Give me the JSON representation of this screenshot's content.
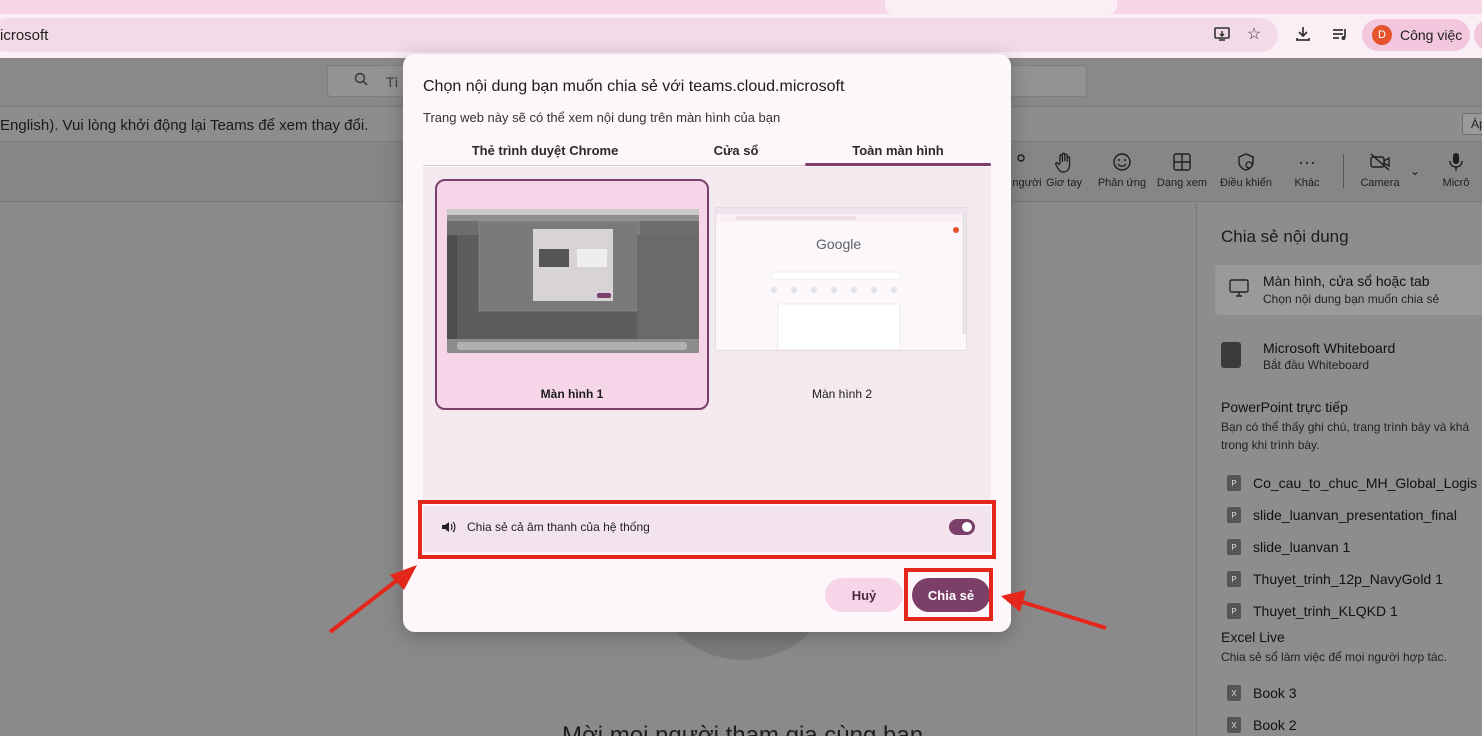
{
  "browser": {
    "url_text": "icrosoft",
    "profile_initial": "D",
    "profile_label": "Công việc",
    "icons": [
      "install-app-icon",
      "bookmark-star-icon",
      "download-icon",
      "reading-list-icon"
    ]
  },
  "teams": {
    "search_placeholder": "Tì",
    "notice_text": "English). Vui lòng khởi động lại Teams để xem thay đổi.",
    "notice_button": "Áp",
    "toolbar": [
      {
        "label": "người",
        "icon": "people-icon"
      },
      {
        "label": "Giơ tay",
        "icon": "raise-hand-icon"
      },
      {
        "label": "Phản ứng",
        "icon": "reaction-icon"
      },
      {
        "label": "Dạng xem",
        "icon": "view-icon"
      },
      {
        "label": "Điều khiển",
        "icon": "controls-icon"
      },
      {
        "label": "Khác",
        "icon": "more-icon"
      },
      {
        "label": "Camera",
        "icon": "camera-off-icon"
      },
      {
        "label": "Micrô",
        "icon": "mic-icon"
      }
    ],
    "stage_text": "Mời mọi người tham gia cùng bạn"
  },
  "share_panel": {
    "title": "Chia sẻ nội dung",
    "screen_option": {
      "title": "Màn hình, cửa sổ hoặc tab",
      "subtitle": "Chọn nội dung bạn muốn chia sẻ"
    },
    "whiteboard": {
      "title": "Microsoft Whiteboard",
      "subtitle": "Bắt đầu Whiteboard"
    },
    "powerpoint": {
      "title": "PowerPoint trực tiếp",
      "desc": "Bạn có thể thấy ghi chú, trang trình bày và khá trong khi trình bày.",
      "files": [
        "Co_cau_to_chuc_MH_Global_Logis",
        "slide_luanvan_presentation_final",
        "slide_luanvan 1",
        "Thuyet_trinh_12p_NavyGold 1",
        "Thuyet_trinh_KLQKD 1"
      ]
    },
    "excel": {
      "title": "Excel Live",
      "desc": "Chia sẻ sổ làm việc để mọi người hợp tác.",
      "files": [
        "Book 3",
        "Book 2"
      ]
    }
  },
  "dialog": {
    "title": "Chọn nội dung bạn muốn chia sẻ với teams.cloud.microsoft",
    "subtitle": "Trang web này sẽ có thể xem nội dung trên màn hình của bạn",
    "tabs": [
      "Thẻ trình duyệt Chrome",
      "Cửa sổ",
      "Toàn màn hình"
    ],
    "active_tab": "Toàn màn hình",
    "screens": [
      {
        "label": "Màn hình 1",
        "selected": true
      },
      {
        "label": "Màn hình 2",
        "selected": false
      }
    ],
    "thumb2_brand": "Google",
    "audio_label": "Chia sẻ cả âm thanh của hệ thống",
    "audio_enabled": true,
    "cancel_label": "Huỷ",
    "share_label": "Chia sẻ"
  },
  "colors": {
    "accent": "#7b3f6a",
    "annotation": "#e5261a",
    "chip": "#f7d5e9"
  }
}
